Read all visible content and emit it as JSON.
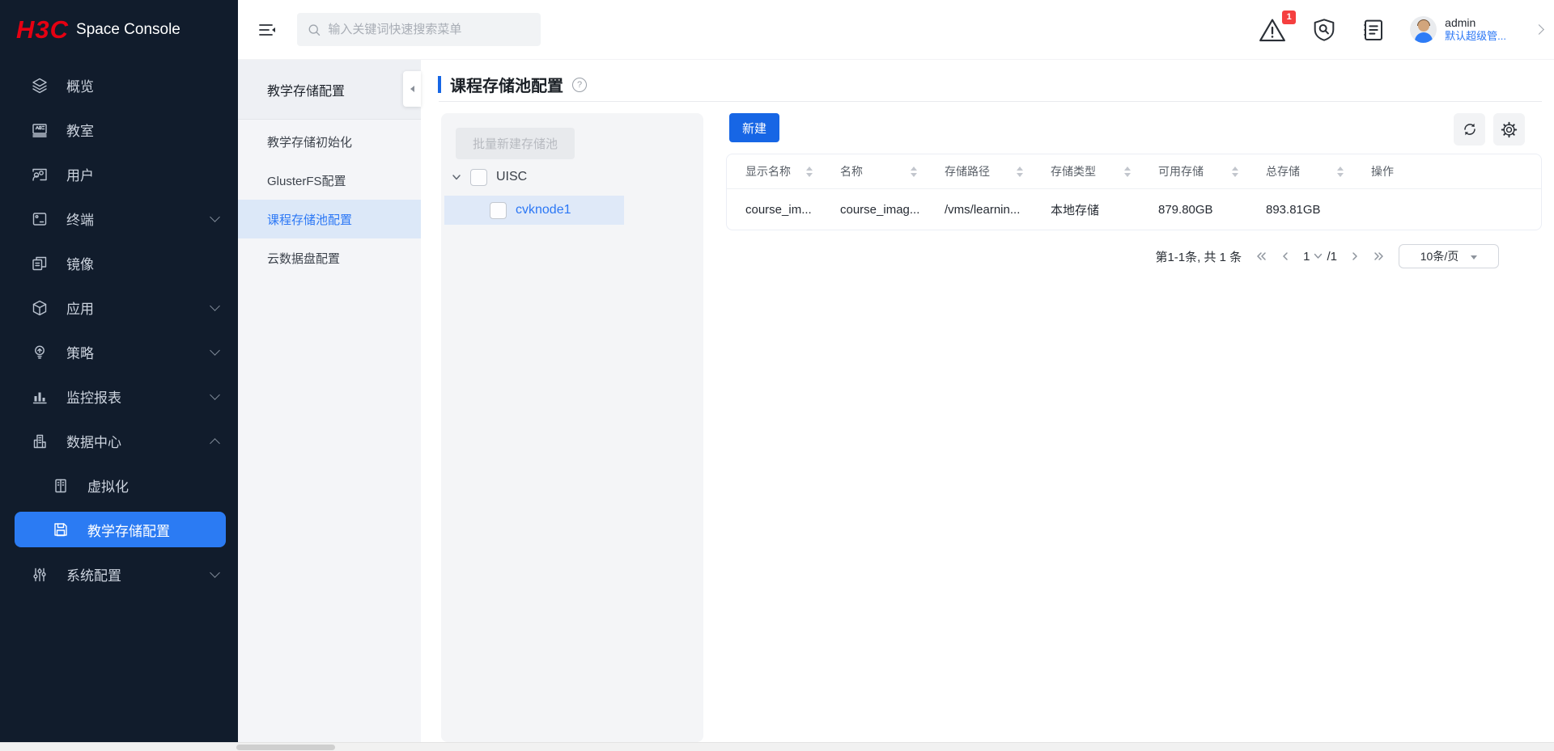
{
  "colors": {
    "accent": "#1766e5",
    "link_blue": "#2b77f5",
    "logo_red": "#e60012",
    "badge_red": "#f53f3f",
    "sidebar_bg": "#111c2c",
    "selected_nav_bg": "#2b7bf3",
    "selected_submenu_bg": "#dce8f8",
    "tree_node_selected_bg": "#dfe9f8"
  },
  "brand": {
    "logo": "H3C",
    "product": "Space Console"
  },
  "topbar": {
    "search_placeholder": "输入关键词快速搜索菜单",
    "alert_count": "1",
    "user": {
      "name": "admin",
      "role": "默认超级管..."
    }
  },
  "sidebar": {
    "items": [
      {
        "label": "概览"
      },
      {
        "label": "教室"
      },
      {
        "label": "用户"
      },
      {
        "label": "终端",
        "expandable": true,
        "expanded": false
      },
      {
        "label": "镜像"
      },
      {
        "label": "应用",
        "expandable": true,
        "expanded": false
      },
      {
        "label": "策略",
        "expandable": true,
        "expanded": false
      },
      {
        "label": "监控报表",
        "expandable": true,
        "expanded": false
      },
      {
        "label": "数据中心",
        "expandable": true,
        "expanded": true
      },
      {
        "label": "虚拟化",
        "child": true
      },
      {
        "label": "教学存储配置",
        "child": true,
        "selected": true
      },
      {
        "label": "系统配置",
        "expandable": true,
        "expanded": false
      }
    ]
  },
  "submenu": {
    "title": "教学存储配置",
    "items": [
      {
        "label": "教学存储初始化"
      },
      {
        "label": "GlusterFS配置"
      },
      {
        "label": "课程存储池配置",
        "selected": true
      },
      {
        "label": "云数据盘配置"
      }
    ]
  },
  "page": {
    "title": "课程存储池配置",
    "help_glyph": "?"
  },
  "tree": {
    "batch_create_label": "批量新建存储池",
    "root_label": "UISC",
    "node_label": "cvknode1"
  },
  "toolbar": {
    "create_label": "新建"
  },
  "table": {
    "columns": [
      {
        "label": "显示名称",
        "sortable": true
      },
      {
        "label": "名称",
        "sortable": true
      },
      {
        "label": "存储路径",
        "sortable": true
      },
      {
        "label": "存储类型",
        "sortable": true
      },
      {
        "label": "可用存储",
        "sortable": true
      },
      {
        "label": "总存储",
        "sortable": true
      },
      {
        "label": "操作",
        "sortable": false
      }
    ],
    "rows": [
      [
        "course_im...",
        "course_imag...",
        "/vms/learnin...",
        "本地存储",
        "879.80GB",
        "893.81GB",
        ""
      ]
    ]
  },
  "pagination": {
    "summary": "第1-1条, 共 1 条",
    "current_page": "1",
    "page_total": "/1",
    "page_size": "10条/页"
  }
}
